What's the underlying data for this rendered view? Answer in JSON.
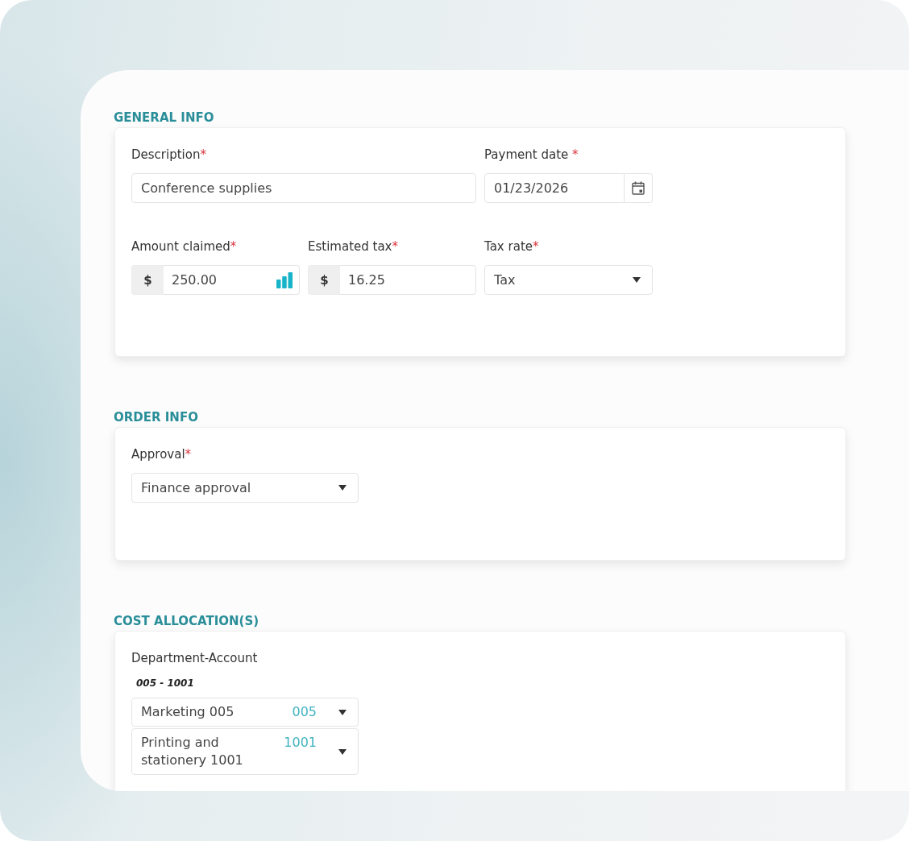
{
  "sections": [
    {
      "title": "GENERAL INFO",
      "kind": "grid",
      "fields": [
        {
          "kind": "text",
          "label": "Description",
          "required_mark": "*",
          "value": "Conference supplies"
        },
        {
          "kind": "date",
          "label": "Payment date",
          "required_mark": " *",
          "value": "01/23/2026"
        },
        {
          "kind": "currency",
          "label": "Amount claimed",
          "required_mark": "*",
          "prefix": "$",
          "value": "250.00",
          "chart_button": true
        },
        {
          "kind": "currency",
          "label": "Estimated tax",
          "required_mark": "*",
          "prefix": "$",
          "value": "16.25",
          "chart_button": false
        },
        {
          "kind": "select",
          "label": "Tax rate",
          "required_mark": "*",
          "value": "Tax"
        }
      ]
    },
    {
      "title": "ORDER INFO",
      "kind": "stack",
      "fields": [
        {
          "kind": "select",
          "label": "Approval",
          "required_mark": "*",
          "value": "Finance approval"
        }
      ]
    },
    {
      "title": "COST ALLOCATION(S)",
      "kind": "stack",
      "fields": [
        {
          "kind": "account",
          "label": "Department-Account",
          "summary": "005 - 1001",
          "selects": [
            {
              "value": "Marketing 005",
              "code": "005"
            },
            {
              "value": "Printing and stationery 1001",
              "code": "1001"
            }
          ]
        }
      ]
    }
  ]
}
